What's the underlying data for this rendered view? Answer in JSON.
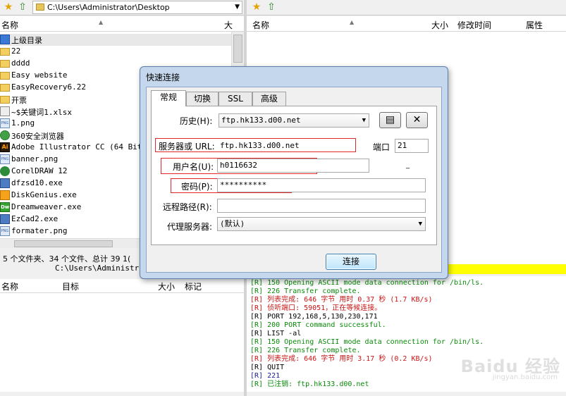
{
  "left_pane": {
    "path": "C:\\Users\\Administrator\\Desktop",
    "col_name": "名称",
    "col_size": "大",
    "files": [
      {
        "name": "上级目录",
        "icon": "up-folder-icon",
        "kind": "up"
      },
      {
        "name": "22",
        "icon": "folder-icon",
        "kind": "folder"
      },
      {
        "name": "dddd",
        "icon": "folder-icon",
        "kind": "folder"
      },
      {
        "name": "Easy website",
        "icon": "folder-icon",
        "kind": "folder"
      },
      {
        "name": "EasyRecovery6.22",
        "icon": "folder-icon",
        "kind": "folder"
      },
      {
        "name": "开票",
        "icon": "folder-icon",
        "kind": "folder"
      },
      {
        "name": "~$关键词1.xlsx",
        "icon": "excel-file-icon",
        "kind": "xls"
      },
      {
        "name": "1.png",
        "icon": "png-file-icon",
        "kind": "png"
      },
      {
        "name": "360安全浏览器",
        "icon": "browser-icon",
        "kind": "browser"
      },
      {
        "name": "Adobe Illustrator CC (64 Bit)",
        "icon": "illustrator-icon",
        "kind": "ai"
      },
      {
        "name": "banner.png",
        "icon": "png-file-icon",
        "kind": "png"
      },
      {
        "name": "CorelDRAW 12",
        "icon": "coreldraw-icon",
        "kind": "corel"
      },
      {
        "name": "dfzsd10.exe",
        "icon": "exe-file-icon",
        "kind": "exe"
      },
      {
        "name": "DiskGenius.exe",
        "icon": "diskgenius-icon",
        "kind": "disk"
      },
      {
        "name": "Dreamweaver.exe",
        "icon": "dreamweaver-icon",
        "kind": "dw"
      },
      {
        "name": "EzCad2.exe",
        "icon": "exe-file-icon",
        "kind": "exe"
      },
      {
        "name": "formater.png",
        "icon": "png-file-icon",
        "kind": "png"
      }
    ],
    "status_line1": "5 个文件夹、34 个文件、总计 39 1(",
    "status_line2": "C:\\Users\\Administrat"
  },
  "right_pane": {
    "col_name": "名称",
    "col_size": "大小",
    "col_modified": "修改时间",
    "col_attr": "属性"
  },
  "queue": {
    "col_name": "名称",
    "col_target": "目标",
    "col_size": "大小",
    "col_mark": "标记"
  },
  "log": [
    {
      "text": "[R] 150 Opening ASCII mode data connection for /bin/ls.",
      "color": "green"
    },
    {
      "text": "[R] 226 Transfer complete.",
      "color": "green"
    },
    {
      "text": "[R] 列表完成: 646 字节 用时 0.37 秒 (1.7 KB/s)",
      "color": "red"
    },
    {
      "text": "[R] 侦听端口: 59051，正在等候连接。",
      "color": "red"
    },
    {
      "text": "[R] PORT 192,168,5,130,230,171",
      "color": "black"
    },
    {
      "text": "[R] 200 PORT command successful.",
      "color": "green"
    },
    {
      "text": "[R] LIST -al",
      "color": "black"
    },
    {
      "text": "[R] 150 Opening ASCII mode data connection for /bin/ls.",
      "color": "green"
    },
    {
      "text": "[R] 226 Transfer complete.",
      "color": "green"
    },
    {
      "text": "[R] 列表完成: 646 字节 用时 3.17 秒 (0.2 KB/s)",
      "color": "red"
    },
    {
      "text": "[R] QUIT",
      "color": "black"
    },
    {
      "text": "[R] 221",
      "color": "blue"
    },
    {
      "text": "[R] 已注销: ftp.hk133.d00.net",
      "color": "green"
    }
  ],
  "dialog": {
    "title": "快速连接",
    "tabs": [
      "常规",
      "切换",
      "SSL",
      "高级"
    ],
    "history_label": "历史(H):",
    "history_value": "ftp.hk133.d00.net",
    "server_label": "服务器或 URL:",
    "server_value": "ftp.hk133.d00.net",
    "port_label": "端口",
    "port_value": "21",
    "username_label": "用户名(U):",
    "username_value": "h0116632",
    "password_label": "密码(P):",
    "password_value": "**********",
    "remote_path_label": "远程路径(R):",
    "remote_path_value": "",
    "proxy_label": "代理服务器:",
    "proxy_value": "(默认)",
    "connect_label": "连接"
  },
  "watermark": {
    "logo": "Baidu 经验",
    "sub": "jingyan.baidu.com"
  },
  "colors": {
    "highlight_red": "#e0282a",
    "log_green": "#0a8a0a",
    "log_red": "#c81414",
    "status_yellow": "#ffff00"
  }
}
